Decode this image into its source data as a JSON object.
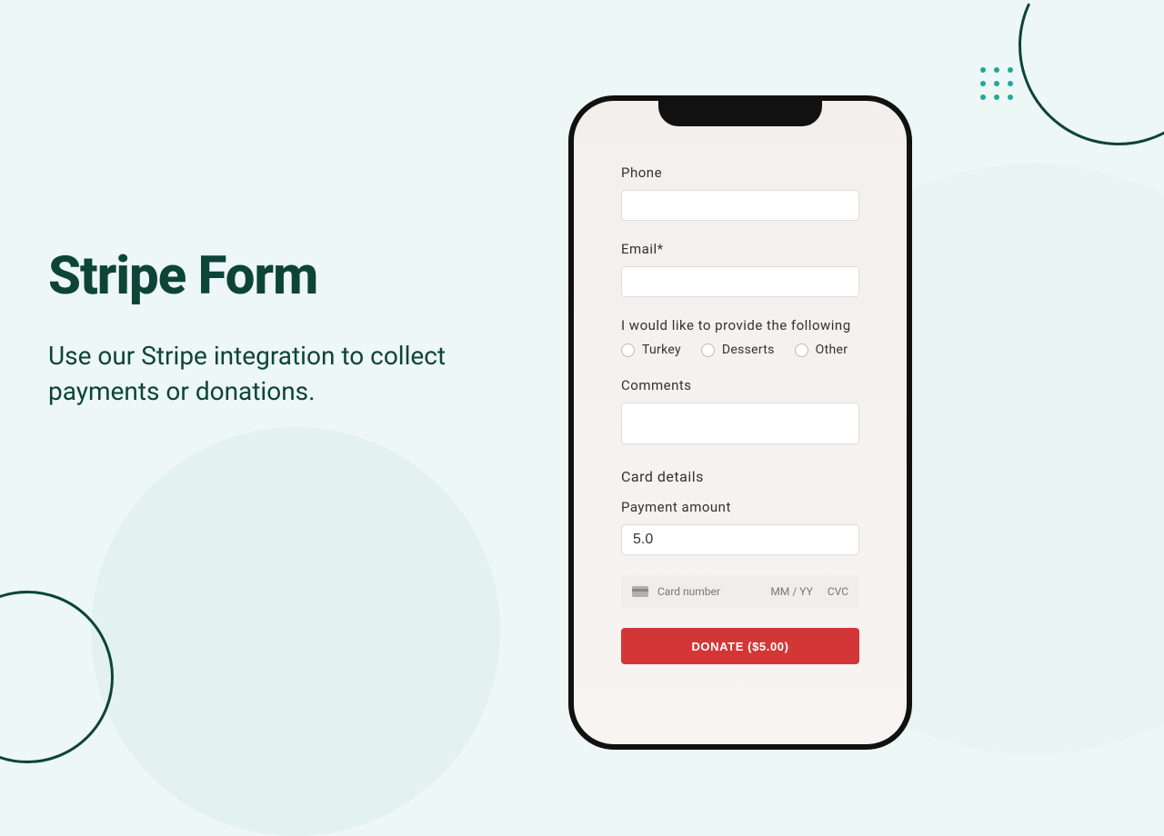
{
  "hero": {
    "title": "Stripe Form",
    "subtitle": "Use our Stripe integration to collect payments or donations."
  },
  "form": {
    "phone_label": "Phone",
    "phone_value": "",
    "email_label": "Email*",
    "email_value": "",
    "provide_label": "I would like to provide the following",
    "options": [
      {
        "label": "Turkey"
      },
      {
        "label": "Desserts"
      },
      {
        "label": "Other"
      }
    ],
    "comments_label": "Comments",
    "comments_value": "",
    "card_details_label": "Card details",
    "amount_label": "Payment amount",
    "amount_value": "5.0",
    "card_number_placeholder": "Card number",
    "card_exp_placeholder": "MM / YY",
    "card_cvc_placeholder": "CVC",
    "button_label": "DONATE ($5.00)"
  }
}
